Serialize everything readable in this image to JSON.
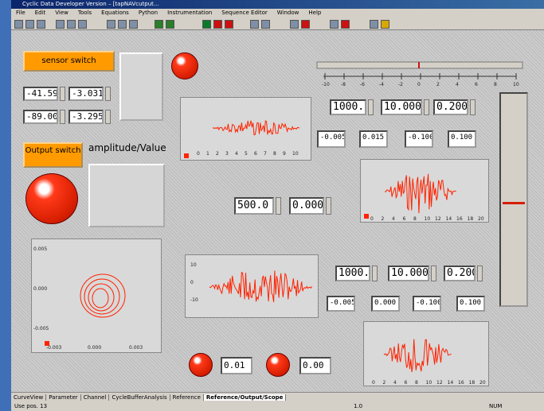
{
  "window": {
    "title": "Cyclic Data Developer Version – [tapNAVcutput..."
  },
  "menu": [
    "File",
    "Edit",
    "View",
    "Tools",
    "Equations",
    "Python",
    "Instrumentation",
    "Sequence Editor",
    "Window",
    "Help"
  ],
  "controls": {
    "sensor_switch_label": "sensor switch",
    "output_switch_label": "Output switch",
    "amplitude_label": "amplitude/Value",
    "values": {
      "v1": "-41.59",
      "v2": "-3.031",
      "v3": "-89.00",
      "v4": "-3.295"
    },
    "top_inputs": [
      "1000.",
      "10.000",
      "0.200"
    ],
    "top_small": [
      "-0.005",
      "0.015",
      "-0.100",
      "0.100"
    ],
    "mid_inputs": [
      "500.0",
      "0.000"
    ],
    "bottom_inputs": [
      "1000.",
      "10.000",
      "0.200"
    ],
    "bottom_small": [
      "-0.005",
      "0.000",
      "-0.100",
      "0.100"
    ],
    "small_fields": [
      "0.01",
      "0.00"
    ]
  },
  "charts": {
    "top_small_ticks": [
      "0",
      "1",
      "2",
      "3",
      "4",
      "5",
      "6",
      "7",
      "8",
      "9",
      "10"
    ],
    "mid_right_ticks": [
      "0",
      "2",
      "4",
      "6",
      "8",
      "10",
      "12",
      "14",
      "16",
      "18",
      "20"
    ],
    "bottom_right_ticks": [
      "0",
      "2",
      "4",
      "6",
      "8",
      "10",
      "12",
      "14",
      "16",
      "18",
      "20"
    ],
    "orbit_y_ticks": [
      "0.005",
      "0.000",
      "-0.005"
    ],
    "orbit_x_ticks": [
      "-0.003",
      "0.000",
      "0.003"
    ],
    "left_y_ticks": [
      "10",
      "0",
      "-10"
    ]
  },
  "ruler_ticks": [
    "-10",
    "-8",
    "-6",
    "-4",
    "-2",
    "0",
    "2",
    "4",
    "6",
    "8",
    "10"
  ],
  "tabs": [
    "CurveView",
    "Parameter",
    "Channel",
    "CycleBufferAnalysis",
    "Reference",
    "Reference/Output/Scope"
  ],
  "status": {
    "left": "Use pos. 13",
    "mid": "1.0",
    "right": "NUM"
  }
}
